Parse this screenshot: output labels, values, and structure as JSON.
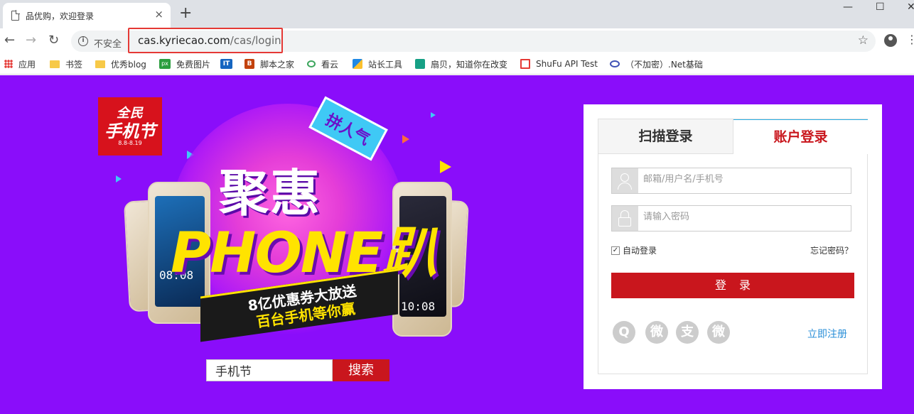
{
  "browser": {
    "tab_title": "品优购，欢迎登录",
    "tab_close": "×",
    "new_tab": "+",
    "window_minimize": "—",
    "window_maximize": "☐",
    "window_close": "✕",
    "back": "←",
    "forward": "→",
    "reload": "↻",
    "security_label": "不安全",
    "url_host": "cas.kyriecao.com",
    "url_path": "/cas/login",
    "star": "☆",
    "menu": "⋮"
  },
  "bookmarks": [
    {
      "label": "应用",
      "icon": "apps-icon",
      "color": "#e53935"
    },
    {
      "label": "书签",
      "icon": "folder-icon",
      "color": "#f7c948"
    },
    {
      "label": "优秀blog",
      "icon": "folder-icon",
      "color": "#f7c948"
    },
    {
      "label": "免费图片",
      "icon": "px-icon",
      "color": "#2c9e3f"
    },
    {
      "label": "",
      "icon": "it-icon",
      "color": "#1565c0"
    },
    {
      "label": "脚本之家",
      "icon": "jb-icon",
      "color": "#c2410c"
    },
    {
      "label": "看云",
      "icon": "cloud-icon",
      "color": "#3ba55c"
    },
    {
      "label": "站长工具",
      "icon": "tools-icon",
      "color": "#1e88e5"
    },
    {
      "label": "扇贝，知道你在改变",
      "icon": "shanbay-icon",
      "color": "#16a085"
    },
    {
      "label": "ShuFu API Test",
      "icon": "shufu-icon",
      "color": "#e53935"
    },
    {
      "label": "（不加密）.Net基础",
      "icon": "cnblogs-icon",
      "color": "#3f51b5"
    }
  ],
  "promo": {
    "logo_line1": "全民",
    "logo_line2": "手机节",
    "logo_date": "8.8-8.19",
    "ribbon": "拼人气",
    "title": "聚惠",
    "phone_word": "PHONE趴",
    "banner_line1": "8亿优惠券大放送",
    "banner_line2": "百台手机等你赢",
    "phone_time_left": "08:08",
    "phone_time_right": "10:08"
  },
  "search": {
    "value": "手机节",
    "button": "搜索"
  },
  "login": {
    "tab_scan": "扫描登录",
    "tab_account": "账户登录",
    "username_placeholder": "邮箱/用户名/手机号",
    "password_placeholder": "请输入密码",
    "remember_label": "自动登录",
    "remember_checked": true,
    "forgot": "忘记密码？",
    "submit": "登录",
    "register": "立即注册",
    "social": [
      {
        "icon": "qq-icon",
        "glyph": "Q"
      },
      {
        "icon": "weibo-icon",
        "glyph": "微"
      },
      {
        "icon": "alipay-icon",
        "glyph": "支"
      },
      {
        "icon": "wechat-icon",
        "glyph": "微"
      }
    ]
  },
  "colors": {
    "page_bg": "#8a0dfa",
    "brand_red": "#c9161d",
    "link_blue": "#2a8fd8",
    "url_highlight": "#e53935"
  }
}
